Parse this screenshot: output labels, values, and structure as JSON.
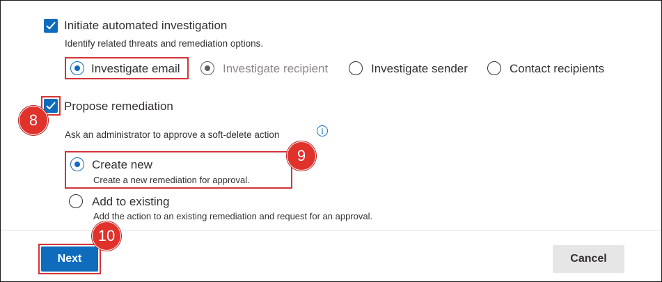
{
  "investigation": {
    "checkbox_label": "Initiate automated investigation",
    "description": "Identify related threats and remediation options.",
    "options": [
      {
        "label": "Investigate email",
        "state": "selected"
      },
      {
        "label": "Investigate recipient",
        "state": "disabled-selected"
      },
      {
        "label": "Investigate sender",
        "state": "unselected"
      },
      {
        "label": "Contact recipients",
        "state": "unselected"
      }
    ]
  },
  "remediation": {
    "checkbox_label": "Propose remediation",
    "description": "Ask an administrator to approve a soft-delete action",
    "info_glyph": "i",
    "create_new": {
      "label": "Create new",
      "description": "Create a new remediation for approval."
    },
    "add_existing": {
      "label": "Add to existing",
      "description": "Add the action to an existing remediation and request for an approval."
    }
  },
  "footer": {
    "next_label": "Next",
    "cancel_label": "Cancel"
  },
  "callouts": {
    "step8": "8",
    "step9": "9",
    "step10": "10"
  },
  "colors": {
    "accent": "#0f6cbd",
    "callout": "#e0312b",
    "highlight_border": "#d13438"
  }
}
